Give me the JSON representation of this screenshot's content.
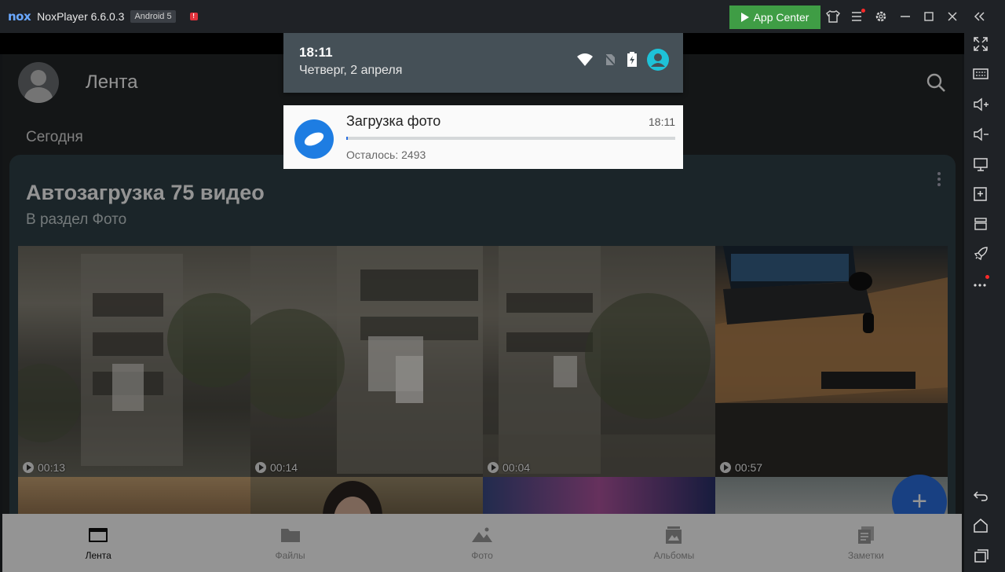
{
  "window": {
    "logo": "nox",
    "app_name": "NoxPlayer 6.6.0.3",
    "android_badge": "Android 5",
    "warning_badge": "!",
    "app_center_label": "App Center",
    "icons": [
      "shirt-icon",
      "menu-icon",
      "gear-icon",
      "minimize-icon",
      "maximize-icon",
      "close-icon",
      "collapse-icon"
    ]
  },
  "sidebar": {
    "icons": [
      "fullscreen-icon",
      "keyboard-icon",
      "volume-up-icon",
      "volume-down-icon",
      "screen-icon",
      "apk-install-icon",
      "multi-instance-icon",
      "rocket-icon",
      "more-icon",
      "back-icon",
      "home-icon",
      "recents-icon"
    ]
  },
  "status_shade": {
    "time": "18:11",
    "date": "Четверг, 2 апреля",
    "icons": [
      "wifi-icon",
      "no-sim-icon",
      "battery-charging-icon",
      "account-icon"
    ]
  },
  "notification": {
    "title": "Загрузка фото",
    "time": "18:11",
    "progress_fraction": 0.004,
    "remaining_text": "Осталось: 2493",
    "accent_color": "#1e7de2"
  },
  "header": {
    "title": "Лента"
  },
  "feed": {
    "section_label": "Сегодня",
    "card": {
      "title": "Автозагрузка 75 видео",
      "subtitle": "В раздел Фото",
      "videos": [
        {
          "duration": "00:13"
        },
        {
          "duration": "00:14"
        },
        {
          "duration": "00:04"
        },
        {
          "duration": "00:57"
        }
      ]
    }
  },
  "fab": {
    "label": "+"
  },
  "bottom_nav": {
    "items": [
      {
        "label": "Лента",
        "active": true
      },
      {
        "label": "Файлы",
        "active": false
      },
      {
        "label": "Фото",
        "active": false
      },
      {
        "label": "Альбомы",
        "active": false
      },
      {
        "label": "Заметки",
        "active": false
      }
    ]
  },
  "colors": {
    "app_center_green": "#3f9d45",
    "brand_blue": "#2a6ee0",
    "card_bg": "#304147"
  }
}
